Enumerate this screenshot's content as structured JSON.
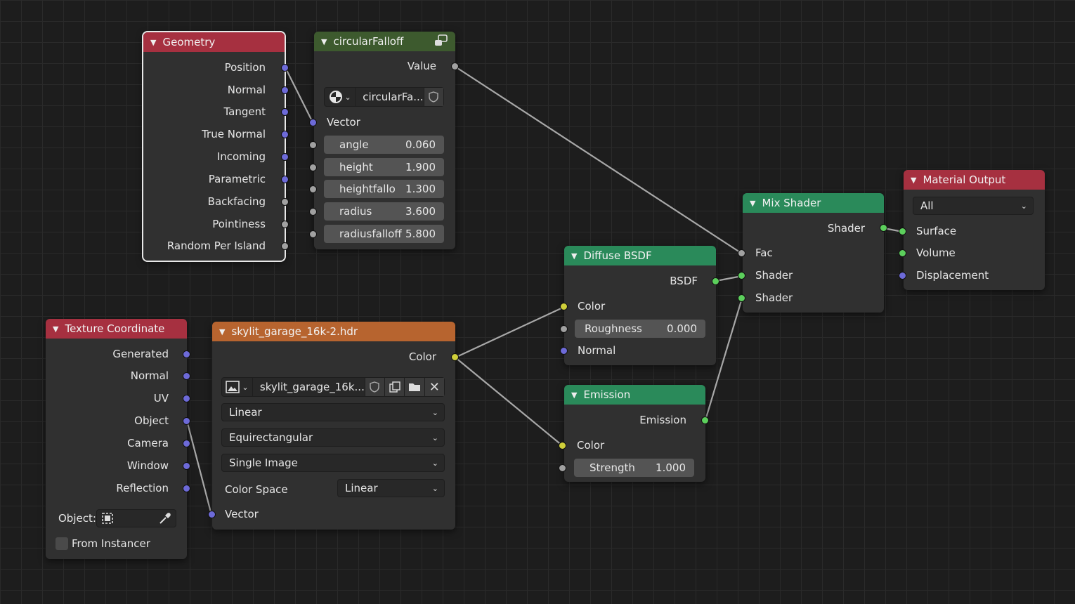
{
  "nodes": {
    "geometry": {
      "title": "Geometry",
      "outputs": [
        "Position",
        "Normal",
        "Tangent",
        "True Normal",
        "Incoming",
        "Parametric",
        "Backfacing",
        "Pointiness",
        "Random Per Island"
      ]
    },
    "circular": {
      "title": "circularFalloff",
      "output": "Value",
      "script_name": "circularFa...",
      "vector_label": "Vector",
      "params": [
        {
          "label": "angle",
          "value": "0.060"
        },
        {
          "label": "height",
          "value": "1.900"
        },
        {
          "label": "heightfallo",
          "value": "1.300"
        },
        {
          "label": "radius",
          "value": "3.600"
        },
        {
          "label": "radiusfalloff",
          "value": "5.800"
        }
      ]
    },
    "texcoord": {
      "title": "Texture Coordinate",
      "outputs": [
        "Generated",
        "Normal",
        "UV",
        "Object",
        "Camera",
        "Window",
        "Reflection"
      ],
      "object_label": "Object:",
      "from_instancer": "From Instancer"
    },
    "image": {
      "title": "skylit_garage_16k-2.hdr",
      "output": "Color",
      "image_name": "skylit_garage_16k...",
      "interpolation": "Linear",
      "projection": "Equirectangular",
      "source": "Single Image",
      "colorspace_label": "Color Space",
      "colorspace_value": "Linear",
      "vector_label": "Vector"
    },
    "diffuse": {
      "title": "Diffuse BSDF",
      "output": "BSDF",
      "color_label": "Color",
      "roughness_label": "Roughness",
      "roughness_value": "0.000",
      "normal_label": "Normal"
    },
    "emission": {
      "title": "Emission",
      "output": "Emission",
      "color_label": "Color",
      "strength_label": "Strength",
      "strength_value": "1.000"
    },
    "mix": {
      "title": "Mix Shader",
      "output": "Shader",
      "inputs": [
        "Fac",
        "Shader",
        "Shader"
      ]
    },
    "output": {
      "title": "Material Output",
      "target": "All",
      "inputs": [
        "Surface",
        "Volume",
        "Displacement"
      ]
    }
  },
  "colors": {
    "socket_vector": "#6d6ad8",
    "socket_float": "#a1a1a1",
    "socket_shader": "#5ccf5c",
    "socket_color": "#cfcf3a",
    "header_input": "#a63040",
    "header_shader": "#2a8a5a",
    "header_texture": "#b7642f",
    "header_script": "#3d5a2e",
    "wire": "#a8a8a8"
  }
}
